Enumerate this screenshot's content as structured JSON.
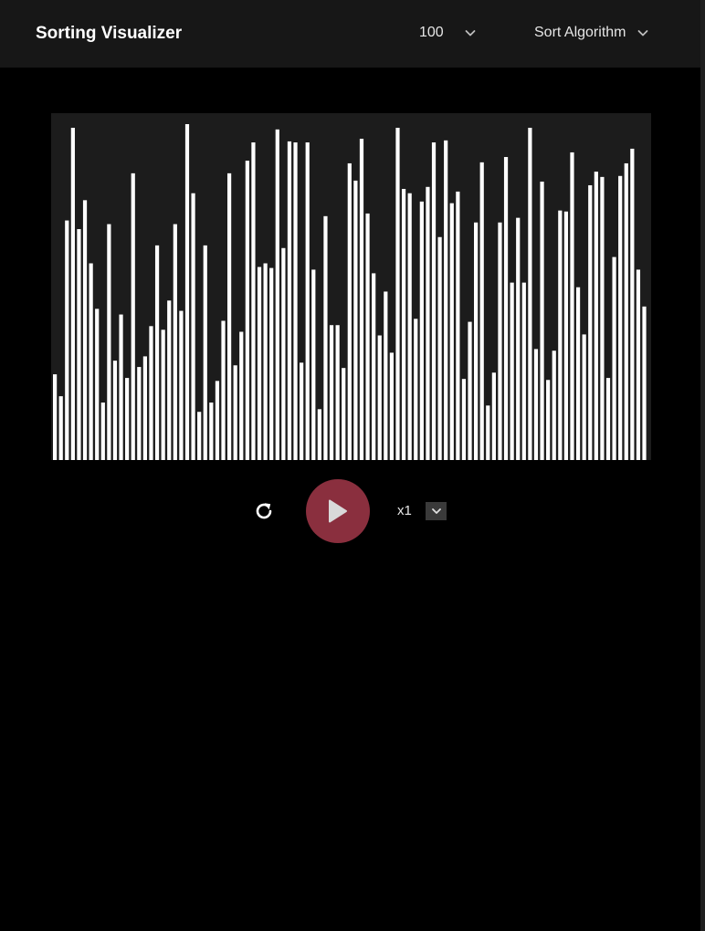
{
  "header": {
    "title": "Sorting Visualizer",
    "array_size": "100",
    "algorithm_placeholder": "Sort Algorithm"
  },
  "controls": {
    "speed_label": "x1"
  },
  "colors": {
    "bar": "#ffffff",
    "canvas_bg": "#1c1c1c",
    "header_bg": "#171717",
    "play_button": "#8a2f3e"
  },
  "icons": {
    "size_dropdown": "chevron-down-icon",
    "algorithm_dropdown": "chevron-down-icon",
    "reset": "refresh-icon",
    "play": "play-icon",
    "speed_dropdown": "chevron-down-icon"
  },
  "array": {
    "max": 100,
    "values": [
      25.8,
      19.2,
      72.1,
      100,
      69.5,
      78.2,
      59.2,
      45.5,
      17.3,
      71,
      29.9,
      43.8,
      24.7,
      86.3,
      28,
      31.2,
      40.3,
      64.6,
      39.2,
      48,
      71,
      44.9,
      101.1,
      80.3,
      14.5,
      64.6,
      17.3,
      23.8,
      41.9,
      86.3,
      28.5,
      38.6,
      90.1,
      95.6,
      58.1,
      59.2,
      57.8,
      99.5,
      63.8,
      95.9,
      95.6,
      29.3,
      95.6,
      57.3,
      15.3,
      73.4,
      40.6,
      40.6,
      27.7,
      89.3,
      84.1,
      96.7,
      74.2,
      56.2,
      37.5,
      50.7,
      32.3,
      100,
      81.6,
      80.3,
      42.5,
      77.8,
      82.2,
      95.6,
      67.1,
      96.2,
      77.3,
      80.8,
      24.4,
      41.6,
      71.5,
      89.6,
      16.4,
      26.3,
      71.5,
      91.2,
      53.4,
      72.9,
      53.4,
      100,
      33.4,
      83.8,
      24.1,
      32.9,
      75.1,
      74.8,
      92.6,
      52,
      37.8,
      82.7,
      86.8,
      85.2,
      24.7,
      61.1,
      85.5,
      89.3,
      93.7,
      57.3,
      46.2
    ]
  }
}
